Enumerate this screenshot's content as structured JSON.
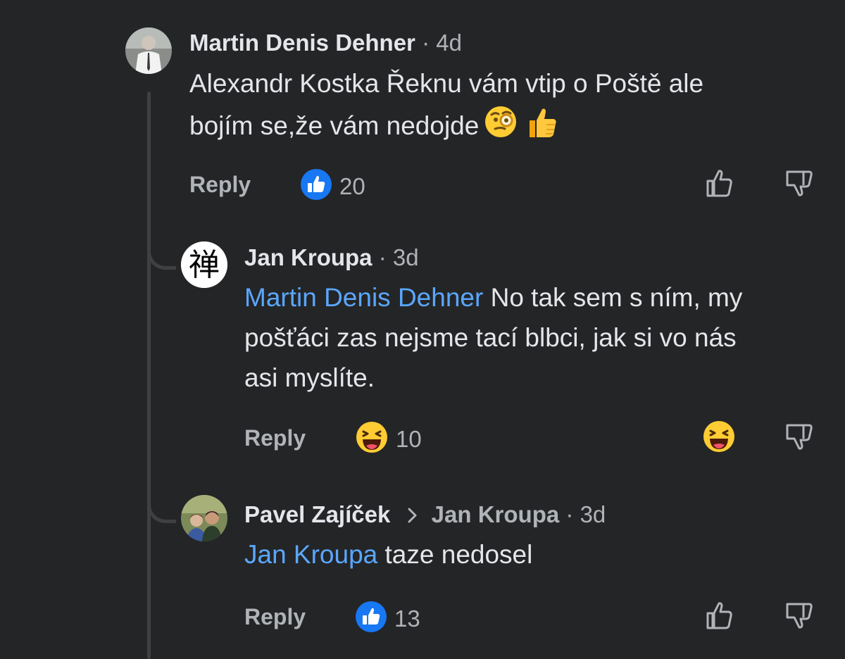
{
  "comments": [
    {
      "author": "Martin Denis Dehner",
      "time": "4d",
      "text": "Alexandr Kostka Řeknu vám vtip o Poště ale bojím se,že vám nedojde",
      "text_line1": "Alexandr Kostka Řeknu vám vtip o Poště ale",
      "text_line2": "bojím se,že vám nedojde",
      "reply_label": "Reply",
      "reaction_count": "20",
      "reaction_icon": "like-icon"
    },
    {
      "author": "Jan Kroupa",
      "time": "3d",
      "mention": "Martin Denis Dehner",
      "text_line1_rest": " No tak sem s ním, my",
      "text_line2": "pošťáci zas nejsme tací blbci, jak si vo nás",
      "text_line3": "asi myslíte.",
      "avatar_glyph": "禅",
      "reply_label": "Reply",
      "reaction_count": "10",
      "reaction_icon": "haha-icon"
    },
    {
      "author": "Pavel Zajíček",
      "reply_target": "Jan Kroupa",
      "time": "3d",
      "mention": "Jan Kroupa",
      "text_rest": " taze nedosel",
      "reply_label": "Reply",
      "reaction_count": "13",
      "reaction_icon": "like-icon"
    }
  ],
  "separator": "·",
  "colors": {
    "background": "#242526",
    "text": "#e4e6eb",
    "secondary": "#b0b3b8",
    "mention": "#5aa7ff",
    "like_blue": "#1877f2"
  }
}
